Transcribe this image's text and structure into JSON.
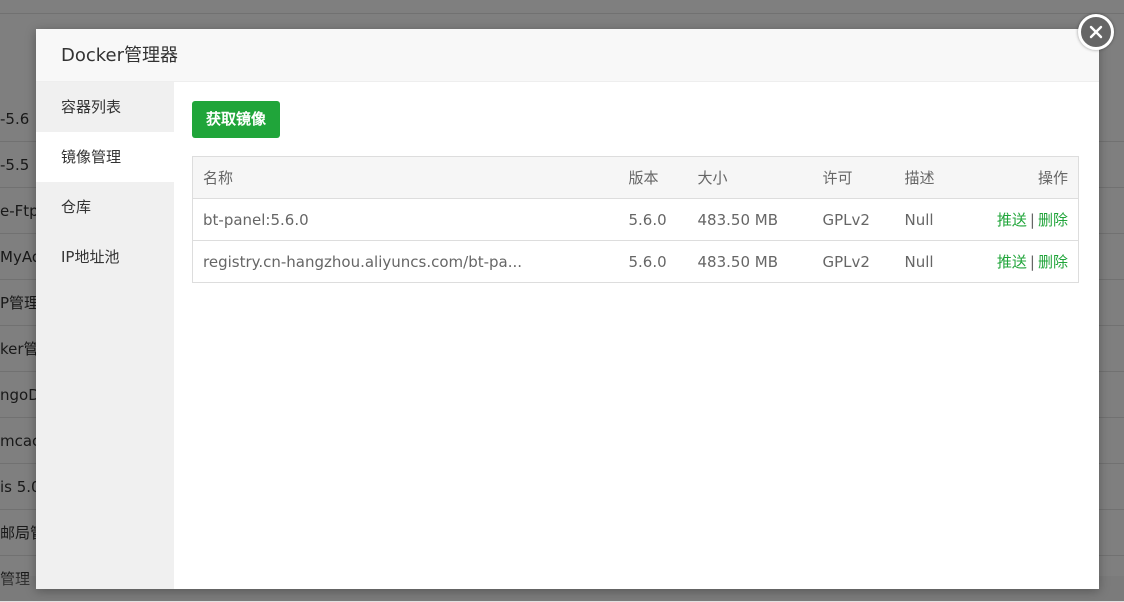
{
  "background_rows": [
    "-5.6",
    "-5.5",
    "e-Ftpd",
    "MyAd",
    "P管理",
    "ker管",
    "ngoD",
    "mcach",
    "is 5.0",
    "邮局管",
    "管理"
  ],
  "modal": {
    "title": "Docker管理器"
  },
  "sidebar": {
    "items": [
      {
        "label": "容器列表",
        "active": false
      },
      {
        "label": "镜像管理",
        "active": true
      },
      {
        "label": "仓库",
        "active": false
      },
      {
        "label": "IP地址池",
        "active": false
      }
    ]
  },
  "toolbar": {
    "pull_label": "获取镜像"
  },
  "table": {
    "headers": {
      "name": "名称",
      "version": "版本",
      "size": "大小",
      "license": "许可",
      "desc": "描述",
      "ops": "操作"
    },
    "rows": [
      {
        "name": "bt-panel:5.6.0",
        "version": "5.6.0",
        "size": "483.50 MB",
        "license": "GPLv2",
        "desc": "Null",
        "push": "推送",
        "sep": "|",
        "delete": "删除"
      },
      {
        "name": "registry.cn-hangzhou.aliyuncs.com/bt-pa...",
        "version": "5.6.0",
        "size": "483.50 MB",
        "license": "GPLv2",
        "desc": "Null",
        "push": "推送",
        "sep": "|",
        "delete": "删除"
      }
    ]
  },
  "colors": {
    "accent": "#20a53a"
  }
}
